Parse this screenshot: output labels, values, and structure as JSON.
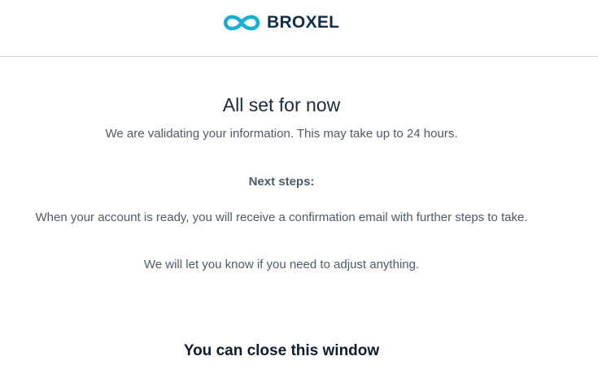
{
  "header": {
    "logo_text": "BROXEL",
    "logo_icon": "infinity-icon",
    "brand_color": "#1aaed1",
    "brand_text_color": "#0e2f4c"
  },
  "main": {
    "title": "All set for now",
    "subtitle": "We are validating your information. This may take up to 24 hours.",
    "next_steps_heading": "Next steps:",
    "next_steps_body": "When your account is ready, you will receive a confirmation email with further steps to take.",
    "adjust_text": "We will let you know if you need to adjust anything.",
    "close_message": "You can close this window"
  }
}
